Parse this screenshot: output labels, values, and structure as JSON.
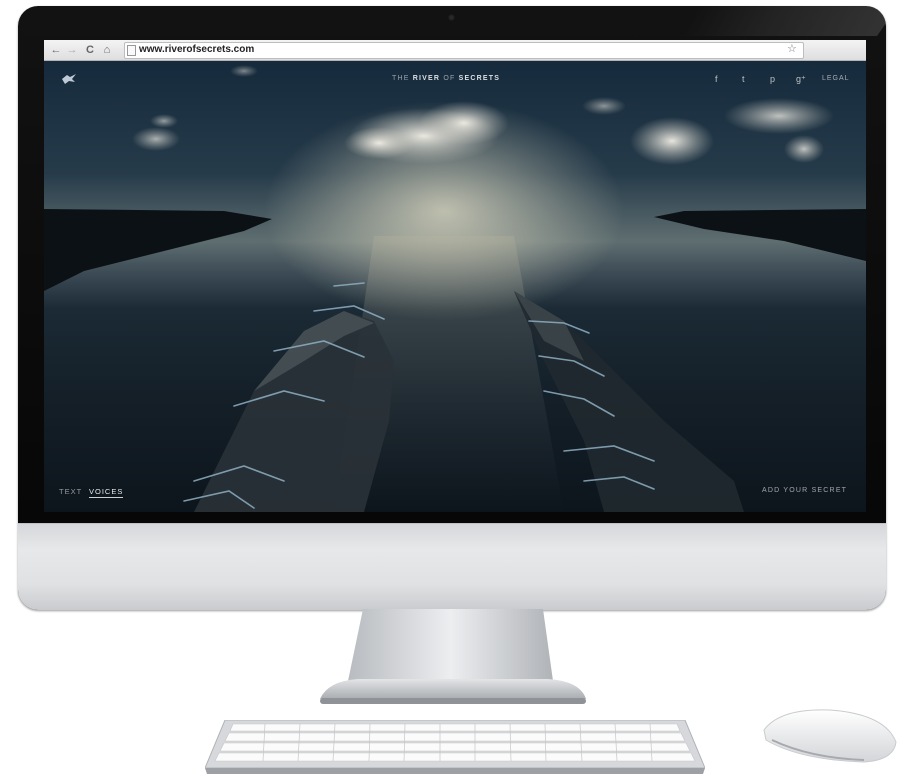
{
  "browser": {
    "back_glyph": "←",
    "forward_glyph": "→",
    "reload_glyph": "C",
    "home_glyph": "⌂",
    "url": "www.riverofsecrets.com",
    "bookmark_glyph": "☆"
  },
  "site": {
    "title_pre": "THE",
    "title_river": "RIVER",
    "title_of": "OF",
    "title_secrets": "SECRETS",
    "social": {
      "facebook": "f",
      "twitter": "t",
      "pinterest": "p",
      "googleplus": "g⁺"
    },
    "legal_label": "LEGAL",
    "tabs": [
      "TEXT",
      "VOICES"
    ],
    "active_tab": "VOICES",
    "add_secret_label": "ADD YOUR SECRET"
  },
  "colors": {
    "bezel": "#0a0a0a",
    "chin": "#dcdee0",
    "sky": "#263b4a",
    "water": "#141f28",
    "accent_light": "#e6e1c8"
  },
  "icons": [
    "logo-bird-icon",
    "facebook-icon",
    "twitter-icon",
    "pinterest-icon",
    "googleplus-icon",
    "star-icon"
  ]
}
